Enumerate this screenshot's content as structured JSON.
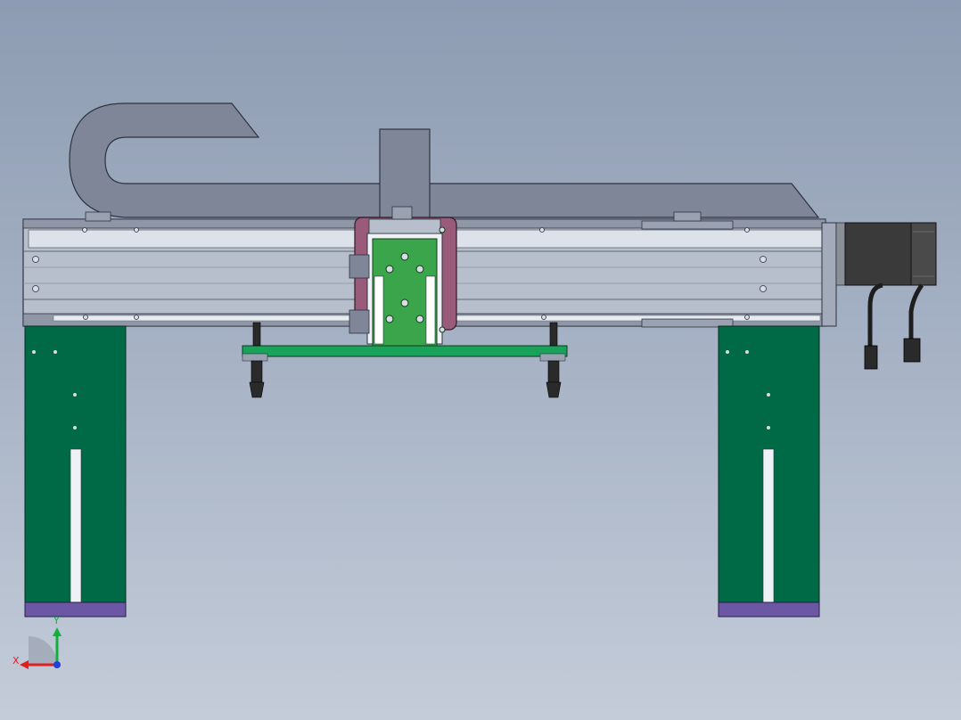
{
  "colors": {
    "background_top": "#8d9cb2",
    "background_bottom": "#c4ccd9",
    "rail_body": "#b7bfcc",
    "rail_shadow": "#5f6573",
    "cable_chain": "#7f8698",
    "leg_green": "#006a46",
    "base_plate": "#6b57a3",
    "carriage_frame": "#9a5a7a",
    "carriage_plate": "#3aa54a",
    "bottom_beam": "#19a35a",
    "motor_body": "#3a3a3a",
    "axis_x": "#e01f1f",
    "axis_y": "#10b03a",
    "axis_z": "#1f3fe0"
  },
  "triad": {
    "x_label": "X",
    "y_label": "Y"
  }
}
